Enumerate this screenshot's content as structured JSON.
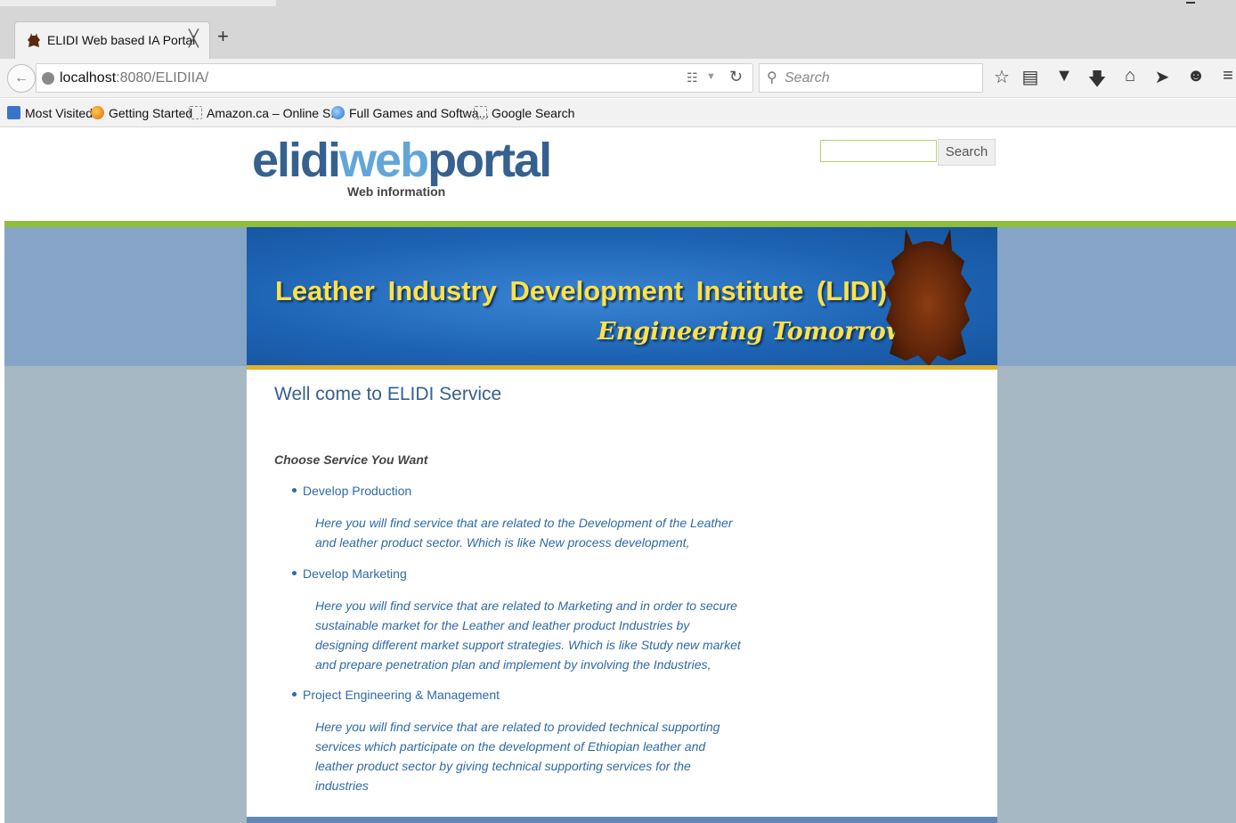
{
  "browser": {
    "tab": {
      "title": "ELIDI Web based IA Portal",
      "close_glyph": "╳"
    },
    "new_tab_glyph": "+",
    "url": {
      "host": "localhost",
      "path": ":8080/ELIDIIA/"
    },
    "search_placeholder": "Search",
    "toolbar_icons": [
      "star-icon",
      "reading-list-icon",
      "pocket-icon",
      "download-icon",
      "home-icon",
      "send-icon",
      "smiley-icon",
      "menu-icon"
    ],
    "bookmarks": [
      {
        "label": "Most Visited",
        "icon": "most-visited-icon"
      },
      {
        "label": "Getting Started",
        "icon": "firefox-icon"
      },
      {
        "label": "Amazon.ca – Online S...",
        "icon": "page-icon"
      },
      {
        "label": "Full Games and Softwa...",
        "icon": "globe-icon"
      },
      {
        "label": "Google Search",
        "icon": "page-icon"
      }
    ]
  },
  "site": {
    "logo": {
      "part1": "elidi",
      "part2": "web",
      "part3": "portal"
    },
    "tagline": "Web information",
    "search_button": "Search",
    "banner": {
      "title": "Leather Industry Development Institute (LIDI)",
      "motto": "Engineering Tomorrow"
    },
    "welcome": "Well come to ELIDI Service",
    "choose_heading": "Choose Service You Want",
    "services": [
      {
        "name": "Develop Production",
        "description": "Here you will find service that are related to the Development of the Leather and leather product sector. Which is like New process development,"
      },
      {
        "name": "Develop Marketing",
        "description": "Here you will find service that are related to Marketing and in order to secure sustainable market for the Leather and leather product Industries by designing different market support strategies. Which is like Study new market and prepare penetration plan and implement by involving the Industries,"
      },
      {
        "name": "Project Engineering & Management",
        "description": "Here you will find service that are related to provided technical supporting services which participate on the development of Ethiopian leather and leather product sector by giving technical supporting services for the industries"
      }
    ]
  },
  "colors": {
    "accent_green": "#8fbe3b",
    "banner_blue": "#1d63b3",
    "banner_text": "#ffe14a",
    "link_blue": "#2f6aa6",
    "logo_dark": "#36618f",
    "logo_light": "#62a6d9"
  }
}
